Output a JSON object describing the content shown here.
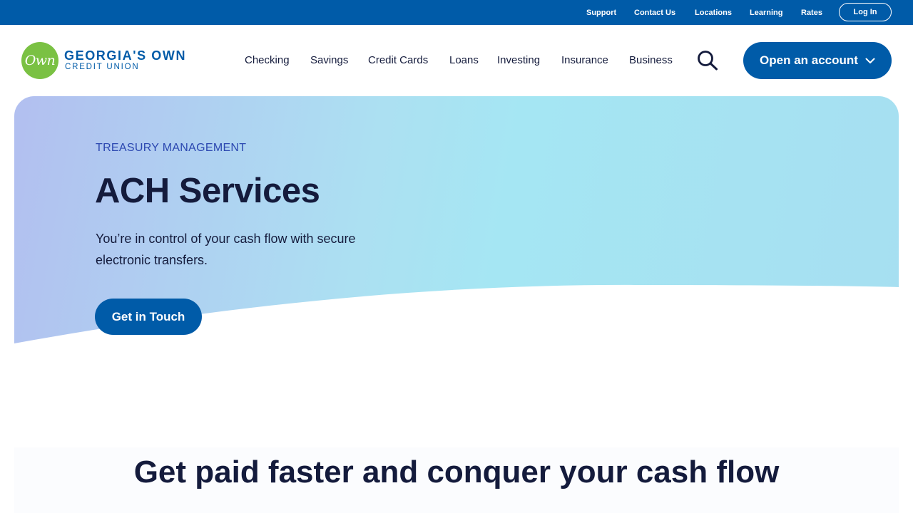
{
  "topbar": {
    "links": [
      "Support",
      "Contact Us",
      "Locations",
      "Learning",
      "Rates"
    ],
    "login_label": "Log In"
  },
  "logo": {
    "mark_text": "Own",
    "line1": "GEORGIA'S OWN",
    "line2": "CREDIT UNION"
  },
  "nav": {
    "items": [
      "Checking",
      "Savings",
      "Credit Cards",
      "Loans",
      "Investing",
      "Insurance",
      "Business"
    ],
    "open_account_label": "Open an account"
  },
  "hero": {
    "eyebrow": "TREASURY MANAGEMENT",
    "title": "ACH Services",
    "description": "You’re in control of your cash flow with secure electronic transfers.",
    "cta_label": "Get in Touch"
  },
  "section": {
    "title": "Get paid faster and conquer your cash flow"
  },
  "colors": {
    "brand_blue": "#005ba8",
    "brand_green": "#7ac143",
    "text_dark": "#141b3c"
  },
  "icons": {
    "search": "search-icon",
    "chevron": "chevron-down-icon",
    "logo": "georgias-own-logo-icon"
  }
}
